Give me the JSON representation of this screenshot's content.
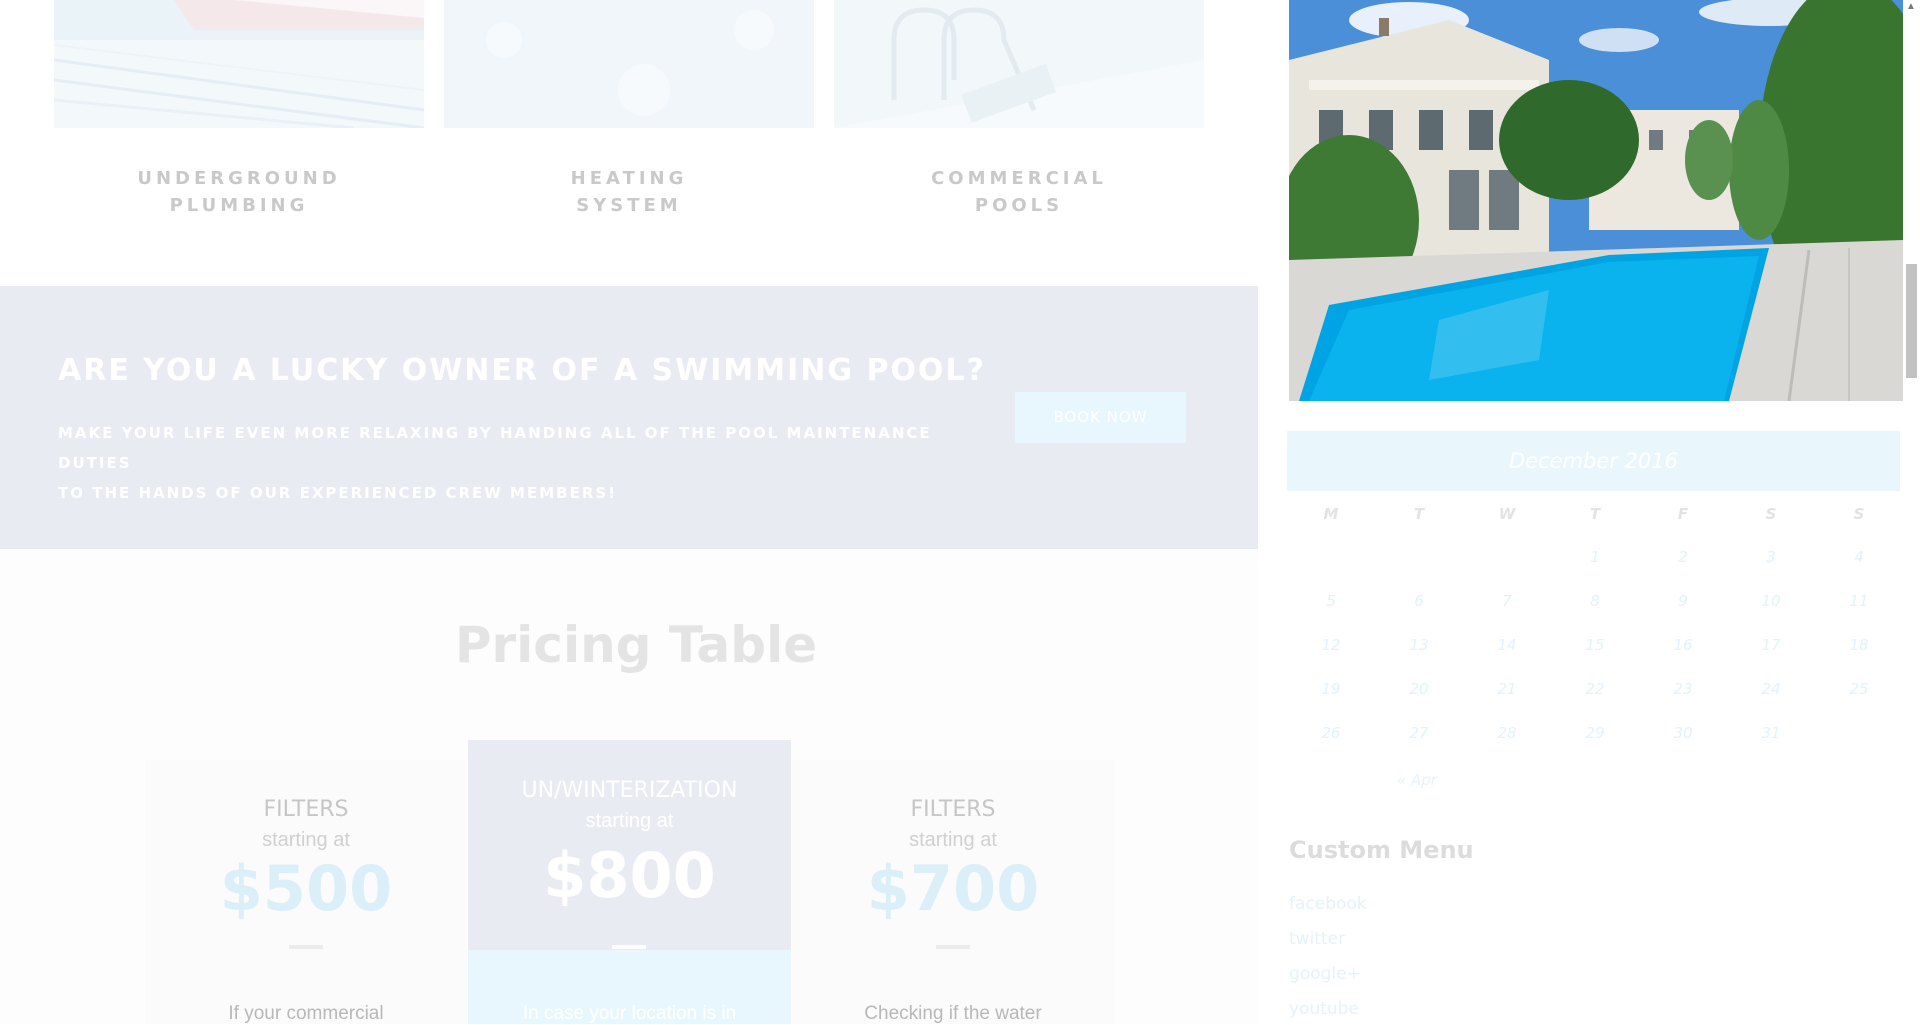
{
  "services": [
    {
      "title_line1": "UNDERGROUND",
      "title_line2": "PLUMBING"
    },
    {
      "title_line1": "HEATING",
      "title_line2": "SYSTEM"
    },
    {
      "title_line1": "COMMERCIAL",
      "title_line2": "POOLS"
    }
  ],
  "cta": {
    "title": "ARE YOU A LUCKY OWNER OF A SWIMMING POOL?",
    "text_line1": "MAKE YOUR LIFE EVEN MORE RELAXING BY HANDING ALL OF THE POOL MAINTENANCE DUTIES",
    "text_line2": "TO THE HANDS OF OUR EXPERIENCED CREW MEMBERS!",
    "button": "BOOK NOW"
  },
  "pricing": {
    "heading": "Pricing Table",
    "plans": [
      {
        "name": "FILTERS",
        "starting": "starting at",
        "price": "$500",
        "desc": "If your commercial"
      },
      {
        "name": "UN/WINTERIZATION",
        "starting": "starting at",
        "price": "$800",
        "desc": "In case your location is in"
      },
      {
        "name": "FILTERS",
        "starting": "starting at",
        "price": "$700",
        "desc": "Checking if the water"
      }
    ]
  },
  "calendar": {
    "month": "December 2016",
    "daynames": [
      "M",
      "T",
      "W",
      "T",
      "F",
      "S",
      "S"
    ],
    "weeks": [
      [
        "",
        "",
        "",
        "1",
        "2",
        "3",
        "4"
      ],
      [
        "5",
        "6",
        "7",
        "8",
        "9",
        "10",
        "11"
      ],
      [
        "12",
        "13",
        "14",
        "15",
        "16",
        "17",
        "18"
      ],
      [
        "19",
        "20",
        "21",
        "22",
        "23",
        "24",
        "25"
      ],
      [
        "26",
        "27",
        "28",
        "29",
        "30",
        "31",
        ""
      ]
    ],
    "prev": "« Apr"
  },
  "custom_menu": {
    "title": "Custom Menu",
    "links": [
      "facebook",
      "twitter",
      "google+",
      "youtube"
    ]
  },
  "colors": {
    "accent": "#e8f7fd",
    "cta_bg": "#e9ebf2",
    "highlight_card": "#e9ebf2"
  }
}
